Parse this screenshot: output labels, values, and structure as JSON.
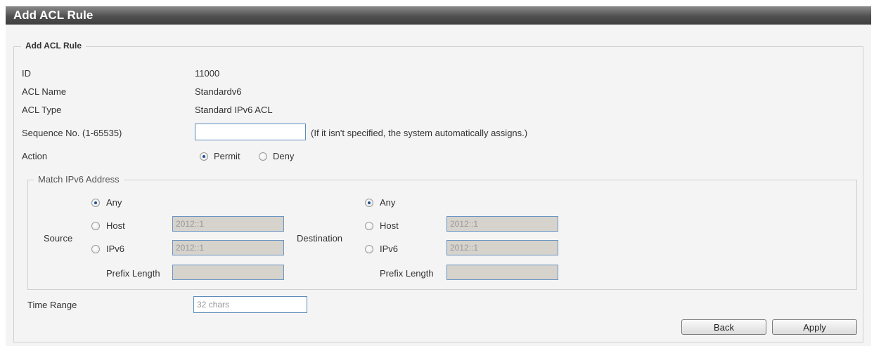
{
  "window": {
    "title": "Add ACL Rule"
  },
  "form": {
    "legend": "Add ACL Rule",
    "id_label": "ID",
    "id_value": "11000",
    "acl_name_label": "ACL Name",
    "acl_name_value": "Standardv6",
    "acl_type_label": "ACL Type",
    "acl_type_value": "Standard IPv6 ACL",
    "sequence_label": "Sequence No. (1-65535)",
    "sequence_value": "",
    "sequence_hint": "(If it isn't specified, the system automatically assigns.)",
    "action_label": "Action",
    "action_options": [
      "Permit",
      "Deny"
    ],
    "action_selected": "Permit",
    "match": {
      "legend": "Match IPv6 Address",
      "source_label": "Source",
      "destination_label": "Destination",
      "any_label": "Any",
      "host_label": "Host",
      "ipv6_label": "IPv6",
      "prefix_label": "Prefix Length",
      "source_selected": "Any",
      "destination_selected": "Any",
      "source_host_placeholder": "2012::1",
      "source_ipv6_placeholder": "2012::1",
      "dest_host_placeholder": "2012::1",
      "dest_ipv6_placeholder": "2012::1"
    },
    "time_range_label": "Time Range",
    "time_range_placeholder": "32 chars"
  },
  "buttons": {
    "back": "Back",
    "apply": "Apply"
  },
  "colors": {
    "title_bar": "#505050",
    "panel_background": "#f4f4f4",
    "input_border": "#5f8dbb",
    "disabled_input": "#d6d2cc",
    "radio_dot": "#1f4e8c"
  }
}
